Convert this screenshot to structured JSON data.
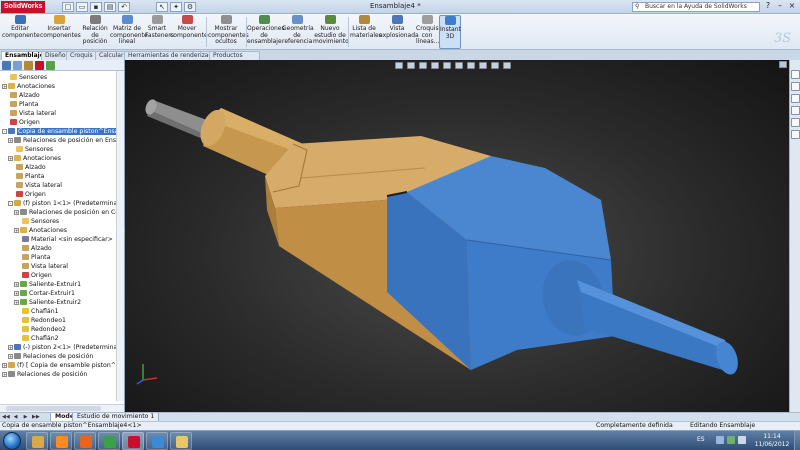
{
  "app": {
    "logo": "SolidWorks",
    "title": "Ensamblaje4 *"
  },
  "quick_access": [
    "new-icon",
    "open-icon",
    "save-icon",
    "print-icon",
    "undo-icon",
    "select-icon",
    "rebuild-icon",
    "options-icon"
  ],
  "help_search": {
    "placeholder": "Buscar en la Ayuda de SolidWorks",
    "icon": "search-icon"
  },
  "window_controls": [
    "help-icon",
    "minimize-icon",
    "restore-icon",
    "close-icon"
  ],
  "ribbon": {
    "buttons": [
      {
        "name": "editar-componente",
        "label": "Editar componente",
        "color": "#3b6fb6"
      },
      {
        "name": "insertar-componentes",
        "label": "Insertar componentes",
        "color": "#d9a335"
      },
      {
        "name": "relacion-de-posicion",
        "label": "Relación de posición",
        "color": "#7c7c7c"
      },
      {
        "name": "matriz-componente-lineal",
        "label": "Matriz de componente lineal",
        "color": "#5c8bd1"
      },
      {
        "name": "smart-fasteners",
        "label": "Smart Fasteners",
        "color": "#9a9a9a"
      },
      {
        "name": "mover-componente",
        "label": "Mover componente",
        "color": "#c74b4b"
      },
      {
        "name": "mostrar-componentes-ocultos",
        "label": "Mostrar componentes ocultos",
        "color": "#8f8f8f"
      },
      {
        "name": "operaciones-de-ensamblaje",
        "label": "Operaciones de ensamblaje",
        "color": "#4f8e4f"
      },
      {
        "name": "geometria-de-referencia",
        "label": "Geometría de referencia",
        "color": "#6a90c8"
      },
      {
        "name": "nuevo-estudio-de-movimiento",
        "label": "Nuevo estudio de movimiento",
        "color": "#5a8a3a"
      },
      {
        "name": "lista-de-materiales",
        "label": "Lista de materiales",
        "color": "#b08a3a"
      },
      {
        "name": "vista-explosionada",
        "label": "Vista explosionada",
        "color": "#4b77b8"
      },
      {
        "name": "croquis-con-lineas",
        "label": "Croquis con líneas...",
        "color": "#9e9e9e"
      },
      {
        "name": "instant-3d",
        "label": "Instant 3D",
        "color": "#3e7fcc"
      }
    ]
  },
  "command_tabs": [
    "Ensamblaje",
    "Diseño",
    "Croquis",
    "Calcular",
    "Herramientas de renderizado",
    "Productos Office"
  ],
  "tree": {
    "rows": [
      {
        "label": "Sensores",
        "indent": 1,
        "icon": "sensor-folder-icon",
        "color": "#e8c45a"
      },
      {
        "label": "Anotaciones",
        "indent": 1,
        "icon": "annotations-icon",
        "color": "#e0b04c",
        "exp": "+"
      },
      {
        "label": "Alzado",
        "indent": 1,
        "icon": "plane-icon",
        "color": "#c9a35e"
      },
      {
        "label": "Planta",
        "indent": 1,
        "icon": "plane-icon",
        "color": "#c9a35e"
      },
      {
        "label": "Vista lateral",
        "indent": 1,
        "icon": "plane-icon",
        "color": "#c9a35e"
      },
      {
        "label": "Origen",
        "indent": 1,
        "icon": "origin-icon",
        "color": "#c44"
      },
      {
        "label": "Copia de ensamble piston^Ensamblaje4<1>",
        "indent": 1,
        "icon": "subassembly-icon",
        "color": "#4b77b8",
        "exp": "-",
        "selected": true
      },
      {
        "label": "Relaciones de posición en Ensamblaje4",
        "indent": 2,
        "icon": "mates-icon",
        "color": "#8a8a8a",
        "exp": "+"
      },
      {
        "label": "Sensores",
        "indent": 2,
        "icon": "sensor-folder-icon",
        "color": "#e8c45a"
      },
      {
        "label": "Anotaciones",
        "indent": 2,
        "icon": "annotations-icon",
        "color": "#e0b04c",
        "exp": "+"
      },
      {
        "label": "Alzado",
        "indent": 2,
        "icon": "plane-icon",
        "color": "#c9a35e"
      },
      {
        "label": "Planta",
        "indent": 2,
        "icon": "plane-icon",
        "color": "#c9a35e"
      },
      {
        "label": "Vista lateral",
        "indent": 2,
        "icon": "plane-icon",
        "color": "#c9a35e"
      },
      {
        "label": "Origen",
        "indent": 2,
        "icon": "origin-icon",
        "color": "#c44"
      },
      {
        "label": "(f) piston 1<1> (Predeterminado)",
        "indent": 2,
        "icon": "part-icon",
        "color": "#d8a64a",
        "exp": "-"
      },
      {
        "label": "Relaciones de posición en Copia",
        "indent": 3,
        "icon": "mates-icon",
        "color": "#8a8a8a",
        "exp": "+"
      },
      {
        "label": "Sensores",
        "indent": 3,
        "icon": "sensor-folder-icon",
        "color": "#e8c45a"
      },
      {
        "label": "Anotaciones",
        "indent": 3,
        "icon": "annotations-icon",
        "color": "#e0b04c",
        "exp": "+"
      },
      {
        "label": "Material <sin especificar>",
        "indent": 3,
        "icon": "material-icon",
        "color": "#7a7a9a"
      },
      {
        "label": "Alzado",
        "indent": 3,
        "icon": "plane-icon",
        "color": "#c9a35e"
      },
      {
        "label": "Planta",
        "indent": 3,
        "icon": "plane-icon",
        "color": "#c9a35e"
      },
      {
        "label": "Vista lateral",
        "indent": 3,
        "icon": "plane-icon",
        "color": "#c9a35e"
      },
      {
        "label": "Origen",
        "indent": 3,
        "icon": "origin-icon",
        "color": "#c44"
      },
      {
        "label": "Saliente-Extruir1",
        "indent": 3,
        "icon": "extrude-icon",
        "color": "#6aa64a",
        "exp": "+"
      },
      {
        "label": "Cortar-Extruir1",
        "indent": 3,
        "icon": "cut-extrude-icon",
        "color": "#6aa64a",
        "exp": "+"
      },
      {
        "label": "Saliente-Extruir2",
        "indent": 3,
        "icon": "extrude-icon",
        "color": "#6aa64a",
        "exp": "+"
      },
      {
        "label": "Chaflán1",
        "indent": 3,
        "icon": "chamfer-icon",
        "color": "#e6c23a"
      },
      {
        "label": "Redondeo1",
        "indent": 3,
        "icon": "fillet-icon",
        "color": "#e6c23a"
      },
      {
        "label": "Redondeo2",
        "indent": 3,
        "icon": "fillet-icon",
        "color": "#e6c23a"
      },
      {
        "label": "Chaflán2",
        "indent": 3,
        "icon": "chamfer-icon",
        "color": "#e6c23a"
      },
      {
        "label": "(-) piston 2<1> (Predeterminado)",
        "indent": 2,
        "icon": "part-icon",
        "color": "#4b77b8",
        "exp": "+"
      },
      {
        "label": "Relaciones de posición",
        "indent": 2,
        "icon": "mates-icon",
        "color": "#8a8a8a",
        "exp": "+"
      },
      {
        "label": "(f) [ Copia de ensamble piston^Ensamblaje4<1> ]",
        "indent": 1,
        "icon": "subassembly-icon",
        "color": "#d8a64a",
        "exp": "+"
      },
      {
        "label": "Relaciones de posición",
        "indent": 1,
        "icon": "mates-icon",
        "color": "#8a8a8a",
        "exp": "+"
      }
    ]
  },
  "bottom_tabs": [
    "Modelo",
    "Estudio de movimiento 1"
  ],
  "status": {
    "left": "Copia de ensamble piston^Ensamblaje4<1>",
    "definition": "Completamente definida",
    "mode": "Editando Ensamblaje"
  },
  "model_colors": {
    "gold": "#c89a55",
    "blue": "#3f7bc4",
    "gray_rod": "#8e8e8e",
    "background": "#2a2a2a"
  },
  "taskbar": {
    "apps": [
      {
        "name": "explorer",
        "color": "#d9a84a"
      },
      {
        "name": "media-player",
        "color": "#ff8a1e"
      },
      {
        "name": "firefox",
        "color": "#e5651e"
      },
      {
        "name": "chrome-like",
        "color": "#3aa04a"
      },
      {
        "name": "solidworks",
        "color": "#c8102e"
      },
      {
        "name": "internet-explorer",
        "color": "#3a8ad6"
      },
      {
        "name": "folder",
        "color": "#e8c66a"
      }
    ],
    "lang": "ES",
    "time": "11:14",
    "date": "11/06/2012"
  }
}
